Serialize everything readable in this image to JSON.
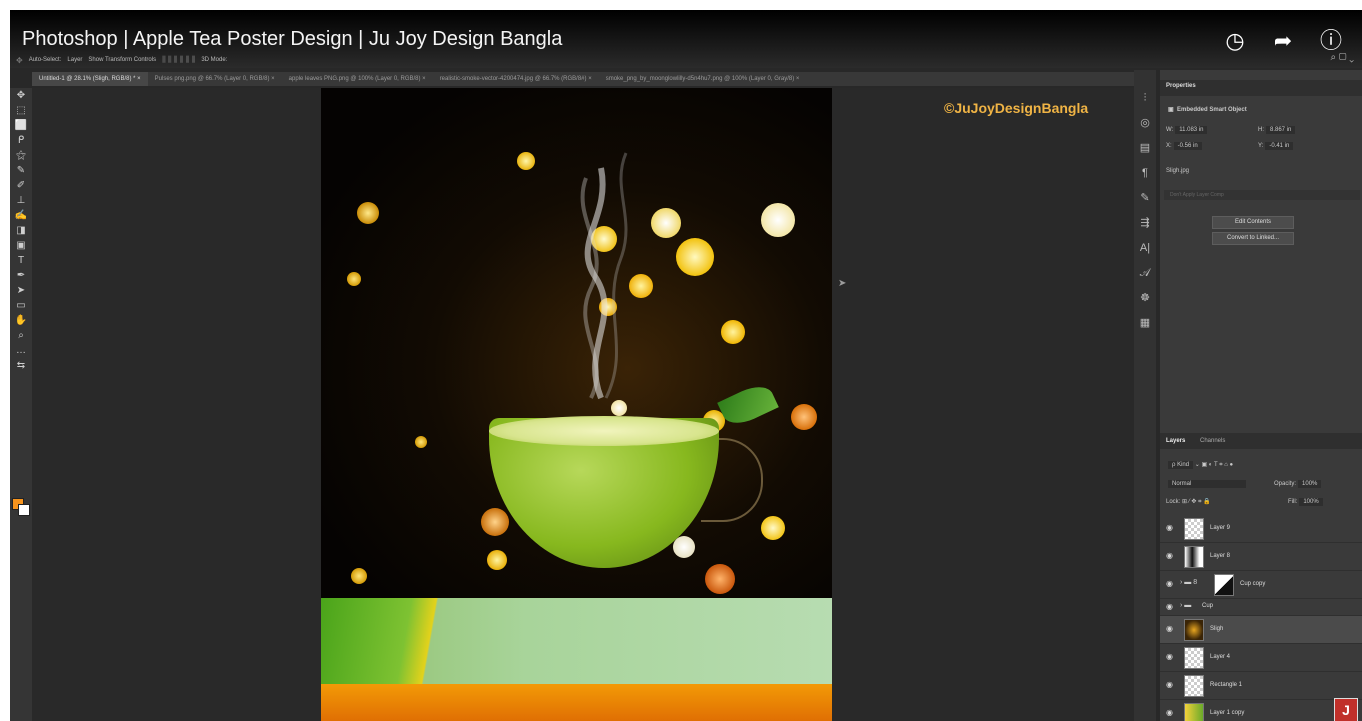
{
  "video": {
    "title": "Photoshop | Apple Tea Poster Design | Ju Joy Design Bangla",
    "icons": [
      "clock-icon",
      "share-icon",
      "info-icon"
    ]
  },
  "options_bar": {
    "items": [
      "Auto-Select:",
      "Layer",
      "Show Transform Controls",
      "3D Mode:"
    ],
    "right": "⌕ ▢ ⌄"
  },
  "tabs": [
    {
      "label": "Untitled-1 @ 28.1% (Sligh, RGB/8) *",
      "active": true
    },
    {
      "label": "Pulses png.png @ 66.7% (Layer 0, RGB/8)",
      "active": false
    },
    {
      "label": "apple leaves PNG.png @ 100% (Layer 0, RGB/8)",
      "active": false
    },
    {
      "label": "realistic-smoke-vector-4200474.jpg @ 66.7% (RGB/8#)",
      "active": false
    },
    {
      "label": "smoke_png_by_moonglowlilly-d5n4hu7.png @ 100% (Layer 0, Gray/8)",
      "active": false
    }
  ],
  "tab_close": "×",
  "canvas": {
    "watermark": "©JuJoyDesignBangla"
  },
  "properties": {
    "tab": "Properties",
    "header": "Embedded Smart Object",
    "w_label": "W:",
    "w_value": "11.083 in",
    "h_label": "H:",
    "h_value": "8.867 in",
    "x_label": "X:",
    "x_value": "-0.56 in",
    "y_label": "Y:",
    "y_value": "-0.41 in",
    "file": "Sligh.jpg",
    "comp_placeholder": "Don't Apply Layer Comp",
    "edit_contents": "Edit Contents",
    "convert_linked": "Convert to Linked..."
  },
  "layers_panel": {
    "tab_layers": "Layers",
    "tab_channels": "Channels",
    "kind": "ρ Kind",
    "blend_mode": "Normal",
    "opacity_label": "Opacity:",
    "opacity_value": "100%",
    "lock_label": "Lock:",
    "fill_label": "Fill:",
    "fill_value": "100%",
    "layers": [
      {
        "name": "Layer 9",
        "selected": false,
        "folder": false
      },
      {
        "name": "Layer 8",
        "selected": false,
        "folder": false
      },
      {
        "name": "Cup copy",
        "selected": false,
        "folder": true
      },
      {
        "name": "Cup",
        "selected": false,
        "folder": true
      },
      {
        "name": "Sligh",
        "selected": true,
        "folder": false
      },
      {
        "name": "Layer 4",
        "selected": false,
        "folder": false
      },
      {
        "name": "Rectangle 1",
        "selected": false,
        "folder": false
      },
      {
        "name": "Layer 1 copy",
        "selected": false,
        "folder": false
      }
    ]
  },
  "badge": "J"
}
